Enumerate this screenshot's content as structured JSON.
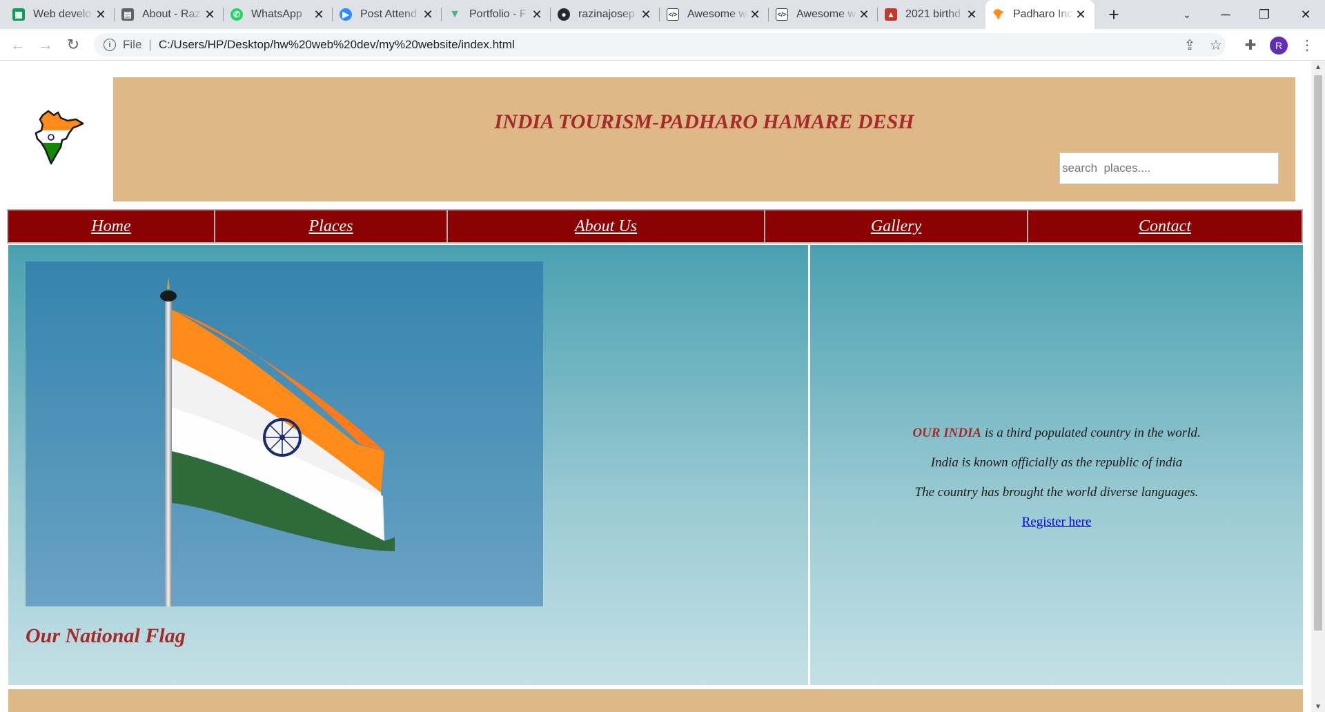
{
  "browser": {
    "tabs": [
      {
        "title": "Web develo",
        "icon": "sheets-icon",
        "color": "#0f9d58"
      },
      {
        "title": "About - Raz",
        "icon": "page-icon",
        "color": "#5f6368"
      },
      {
        "title": "WhatsApp",
        "icon": "whatsapp-icon",
        "color": "#25d366"
      },
      {
        "title": "Post Attend",
        "icon": "zoom-icon",
        "color": "#2d8cff"
      },
      {
        "title": "Portfolio - F",
        "icon": "vue-icon",
        "color": "#41b883"
      },
      {
        "title": "razinajosep",
        "icon": "github-icon",
        "color": "#24292e"
      },
      {
        "title": "Awesome w",
        "icon": "code-icon",
        "color": "#3c4043"
      },
      {
        "title": "Awesome w",
        "icon": "code-icon",
        "color": "#3c4043"
      },
      {
        "title": "2021 birthd",
        "icon": "cake-icon",
        "color": "#c0392b"
      },
      {
        "title": "Padharo Inc",
        "icon": "india-map-icon",
        "color": "#ff8c1a",
        "active": true
      }
    ],
    "address": {
      "scheme": "File",
      "url": "C:/Users/HP/Desktop/hw%20web%20dev/my%20website/index.html"
    },
    "profile_initial": "R"
  },
  "page": {
    "title": "INDIA TOURISM-PADHARO HAMARE DESH",
    "search_placeholder": "search  places....",
    "nav": [
      "Home",
      "Places",
      "About Us",
      "Gallery",
      "Contact"
    ],
    "flag_caption": "Our National Flag",
    "info": {
      "highlight": "OUR INDIA",
      "line1_rest": " is a third populated country in the world.",
      "line2": "India is known officially as the republic of india",
      "line3": "The country has brought the world diverse languages.",
      "register_link": "Register here"
    },
    "colors": {
      "banner": "#deb887",
      "title": "#a52a2a",
      "navbar": "#8b0000"
    }
  }
}
